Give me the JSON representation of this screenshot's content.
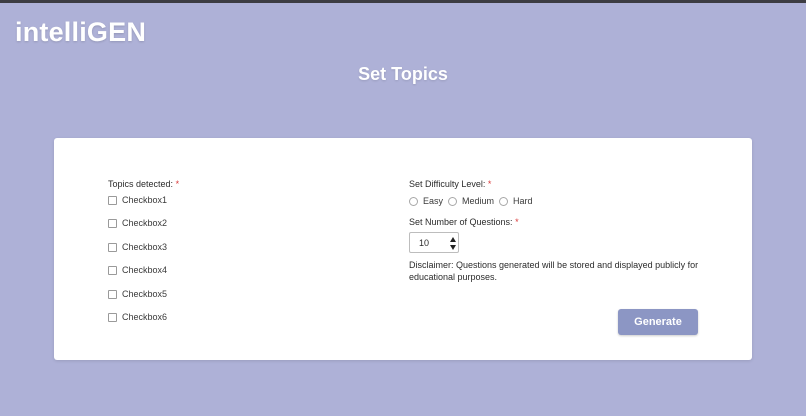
{
  "header": {
    "logo": "intelliGEN",
    "title": "Set Topics"
  },
  "topics": {
    "label": "Topics detected:",
    "required_mark": "*",
    "items": [
      {
        "label": "Checkbox1",
        "checked": false
      },
      {
        "label": "Checkbox2",
        "checked": false
      },
      {
        "label": "Checkbox3",
        "checked": false
      },
      {
        "label": "Checkbox4",
        "checked": false
      },
      {
        "label": "Checkbox5",
        "checked": false
      },
      {
        "label": "Checkbox6",
        "checked": false
      }
    ]
  },
  "difficulty": {
    "label": "Set Difficulty Level:",
    "required_mark": "*",
    "options": [
      {
        "label": "Easy",
        "selected": false
      },
      {
        "label": "Medium",
        "selected": false
      },
      {
        "label": "Hard",
        "selected": false
      }
    ]
  },
  "questions": {
    "label": "Set Number of Questions:",
    "required_mark": "*",
    "value": "10"
  },
  "disclaimer": "Disclaimer: Questions generated will be stored and displayed publicly for educational purposes.",
  "actions": {
    "generate_label": "Generate"
  },
  "colors": {
    "background": "#aeb1d7",
    "card": "#ffffff",
    "button": "#8c96c4",
    "required": "#d93a3a"
  }
}
